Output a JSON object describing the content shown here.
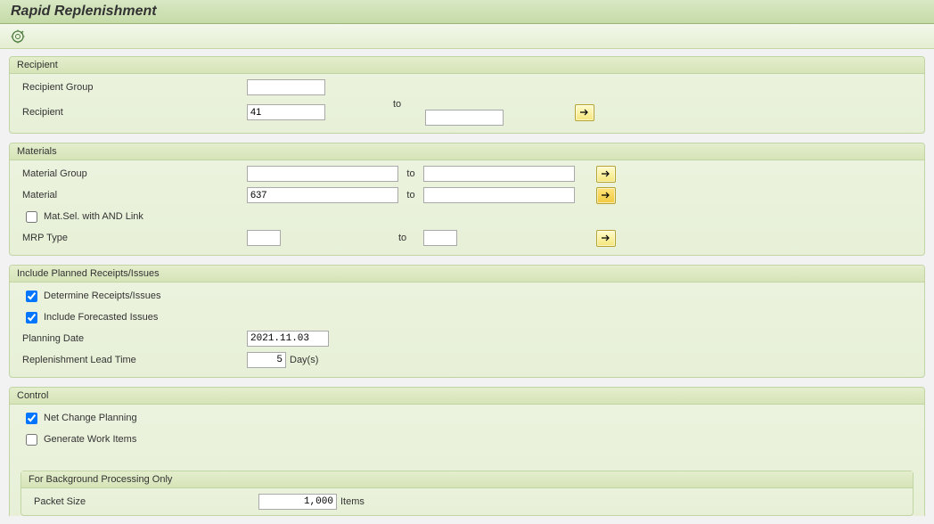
{
  "title": "Rapid Replenishment",
  "groups": {
    "recipient": {
      "title": "Recipient",
      "recipient_group_label": "Recipient Group",
      "recipient_group_value": "",
      "recipient_label": "Recipient",
      "recipient_from": "41",
      "to_label": "to",
      "recipient_to": ""
    },
    "materials": {
      "title": "Materials",
      "material_group_label": "Material Group",
      "material_group_from": "",
      "material_group_to": "",
      "material_label": "Material",
      "material_from": "637",
      "material_to": "",
      "matsel_label": "Mat.Sel. with AND Link",
      "mrp_type_label": "MRP Type",
      "mrp_from": "",
      "mrp_to": "",
      "to_label": "to"
    },
    "planned": {
      "title": "Include Planned Receipts/Issues",
      "determine_label": "Determine Receipts/Issues",
      "forecast_label": "Include Forecasted Issues",
      "planning_date_label": "Planning Date",
      "planning_date_value": "2021.11.03",
      "replenish_label": "Replenishment Lead Time",
      "replenish_value": "5",
      "days_unit": "Day(s)"
    },
    "control": {
      "title": "Control",
      "netchange_label": "Net Change Planning",
      "genwork_label": "Generate Work Items"
    },
    "background": {
      "title": "For Background Processing Only",
      "packet_label": "Packet Size",
      "packet_value": "1,000",
      "items_unit": "Items"
    }
  }
}
